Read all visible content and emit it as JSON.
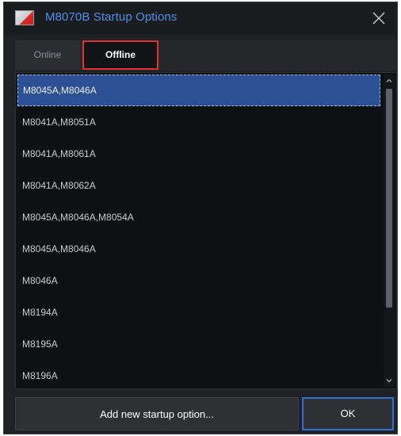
{
  "window": {
    "title": "M8070B Startup Options",
    "icon": "app-flag-icon",
    "close_icon": "close-icon"
  },
  "tabs": [
    {
      "label": "Online",
      "selected": false
    },
    {
      "label": "Offline",
      "selected": true
    }
  ],
  "list": {
    "items": [
      {
        "label": "M8045A,M8046A",
        "selected": true
      },
      {
        "label": "M8041A,M8051A",
        "selected": false
      },
      {
        "label": "M8041A,M8061A",
        "selected": false
      },
      {
        "label": "M8041A,M8062A",
        "selected": false
      },
      {
        "label": "M8045A,M8046A,M8054A",
        "selected": false
      },
      {
        "label": "M8045A,M8046A",
        "selected": false
      },
      {
        "label": "M8046A",
        "selected": false
      },
      {
        "label": "M8194A",
        "selected": false
      },
      {
        "label": "M8195A",
        "selected": false
      },
      {
        "label": "M8196A",
        "selected": false
      }
    ]
  },
  "buttons": {
    "add_label": "Add new startup option...",
    "ok_label": "OK"
  },
  "colors": {
    "title_text": "#4d8fe6",
    "selection": "#2d4f93",
    "offline_tab_highlight": "#e03131",
    "ok_border": "#2f6fd6"
  }
}
